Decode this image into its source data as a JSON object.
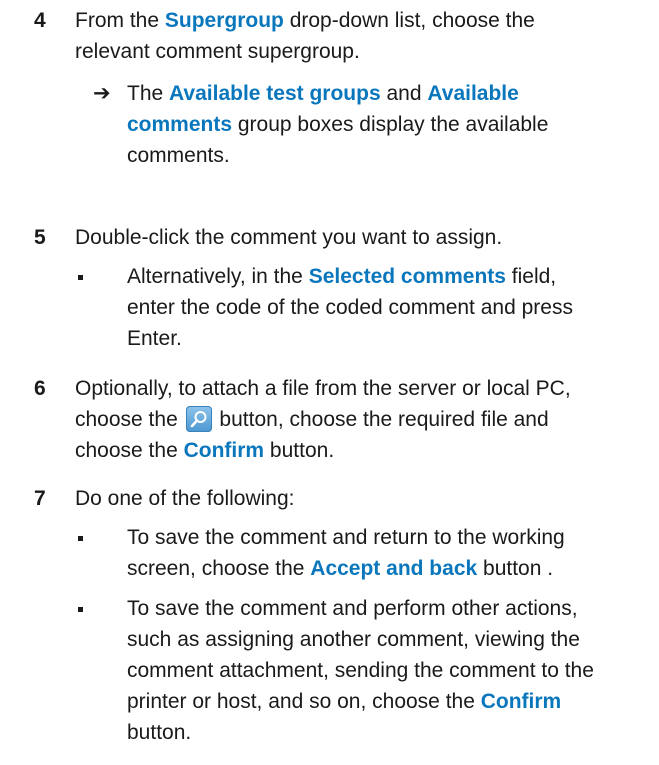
{
  "steps": [
    {
      "number": "4",
      "text_a": "From the ",
      "kw_a": "Supergroup",
      "text_b": " drop-down list, choose the",
      "line2": "relevant comment supergroup.",
      "result": {
        "marker": "➔",
        "text_a": "The ",
        "kw_a": "Available test groups",
        "text_b": " and ",
        "kw_b": "Available",
        "kw_c": "comments",
        "text_c": " group boxes display the available",
        "line3": "comments."
      }
    },
    {
      "number": "5",
      "line1": "Double-click the comment you want to assign.",
      "sub": {
        "text_a": "Alternatively, in the ",
        "kw_a": "Selected comments",
        "text_b": " field,",
        "line2": "enter the code of the coded comment and press",
        "line3": "Enter."
      }
    },
    {
      "number": "6",
      "line1": "Optionally, to attach a file from the server or local PC,",
      "text_a": "choose the ",
      "icon": "search-icon",
      "text_b": " button, choose the required file and",
      "text_c": "choose the ",
      "kw_a": "Confirm",
      "text_d": " button."
    },
    {
      "number": "7",
      "line1": "Do one of the following:",
      "sub1": {
        "line1": "To save the comment and return to the working",
        "text_a": "screen, choose the ",
        "kw_a": "Accept and back",
        "text_b": " button ."
      },
      "sub2": {
        "line1": "To save the comment and perform other actions,",
        "line2": "such as assigning another comment, viewing the",
        "line3": "comment attachment, sending the comment to the",
        "text_a": "printer or host, and so on, choose the ",
        "kw_a": "Confirm",
        "line5": "button."
      }
    }
  ],
  "colors": {
    "keyword": "#0a77bd",
    "text": "#1a1a1a"
  }
}
